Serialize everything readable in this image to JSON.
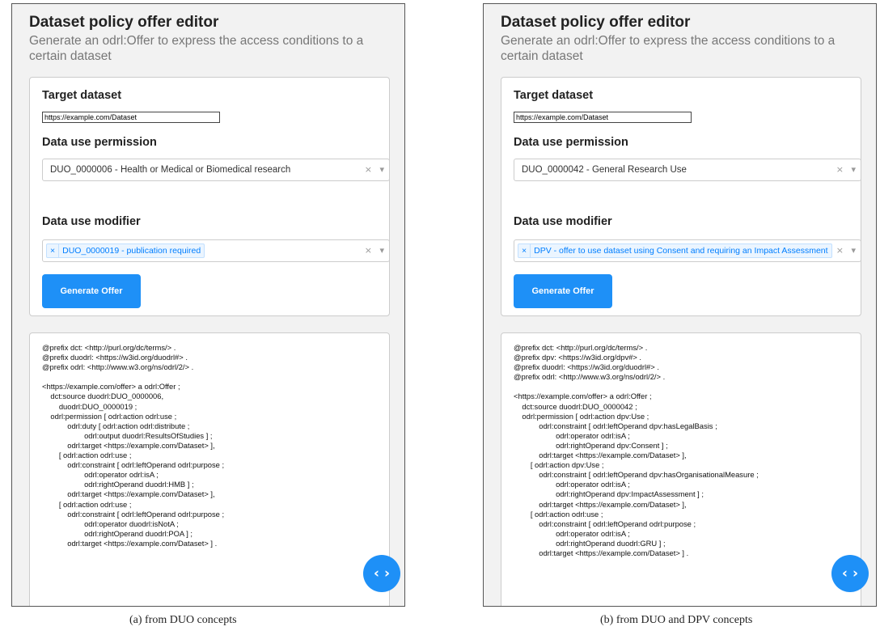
{
  "panels": [
    {
      "title": "Dataset policy offer editor",
      "subtitle": "Generate an odrl:Offer to express the access conditions to a certain dataset",
      "target_label": "Target dataset",
      "target_value": "https://example.com/Dataset",
      "permission_label": "Data use permission",
      "permission_value": "DUO_0000006 - Health or Medical or Biomedical research",
      "modifier_label": "Data use modifier",
      "modifier_chip": "DUO_0000019 - publication required",
      "chip_remove": "×",
      "clear_icon": "×",
      "dropdown_icon": "▾",
      "generate_label": "Generate Offer",
      "toggle_label": "‹ ›",
      "code": "@prefix dct: <http://purl.org/dc/terms/> .\n@prefix duodrl: <https://w3id.org/duodrl#> .\n@prefix odrl: <http://www.w3.org/ns/odrl/2/> .\n\n<https://example.com/offer> a odrl:Offer ;\n    dct:source duodrl:DUO_0000006,\n        duodrl:DUO_0000019 ;\n    odrl:permission [ odrl:action odrl:use ;\n            odrl:duty [ odrl:action odrl:distribute ;\n                    odrl:output duodrl:ResultsOfStudies ] ;\n            odrl:target <https://example.com/Dataset> ],\n        [ odrl:action odrl:use ;\n            odrl:constraint [ odrl:leftOperand odrl:purpose ;\n                    odrl:operator odrl:isA ;\n                    odrl:rightOperand duodrl:HMB ] ;\n            odrl:target <https://example.com/Dataset> ],\n        [ odrl:action odrl:use ;\n            odrl:constraint [ odrl:leftOperand odrl:purpose ;\n                    odrl:operator duodrl:isNotA ;\n                    odrl:rightOperand duodrl:POA ] ;\n            odrl:target <https://example.com/Dataset> ] ."
    },
    {
      "title": "Dataset policy offer editor",
      "subtitle": "Generate an odrl:Offer to express the access conditions to a certain dataset",
      "target_label": "Target dataset",
      "target_value": "https://example.com/Dataset",
      "permission_label": "Data use permission",
      "permission_value": "DUO_0000042 - General Research Use",
      "modifier_label": "Data use modifier",
      "modifier_chip": "DPV - offer to use dataset using Consent and requiring an Impact Assessment",
      "chip_remove": "×",
      "clear_icon": "×",
      "dropdown_icon": "▾",
      "generate_label": "Generate Offer",
      "toggle_label": "‹ ›",
      "code": "@prefix dct: <http://purl.org/dc/terms/> .\n@prefix dpv: <https://w3id.org/dpv#> .\n@prefix duodrl: <https://w3id.org/duodrl#> .\n@prefix odrl: <http://www.w3.org/ns/odrl/2/> .\n\n<https://example.com/offer> a odrl:Offer ;\n    dct:source duodrl:DUO_0000042 ;\n    odrl:permission [ odrl:action dpv:Use ;\n            odrl:constraint [ odrl:leftOperand dpv:hasLegalBasis ;\n                    odrl:operator odrl:isA ;\n                    odrl:rightOperand dpv:Consent ] ;\n            odrl:target <https://example.com/Dataset> ],\n        [ odrl:action dpv:Use ;\n            odrl:constraint [ odrl:leftOperand dpv:hasOrganisationalMeasure ;\n                    odrl:operator odrl:isA ;\n                    odrl:rightOperand dpv:ImpactAssessment ] ;\n            odrl:target <https://example.com/Dataset> ],\n        [ odrl:action odrl:use ;\n            odrl:constraint [ odrl:leftOperand odrl:purpose ;\n                    odrl:operator odrl:isA ;\n                    odrl:rightOperand duodrl:GRU ] ;\n            odrl:target <https://example.com/Dataset> ] ."
    }
  ],
  "captions": [
    "(a) from DUO concepts",
    "(b) from DUO and DPV concepts"
  ],
  "colors": {
    "accent": "#1e90f7",
    "chip_text": "#007eff",
    "chip_bg": "#ebf5ff"
  }
}
